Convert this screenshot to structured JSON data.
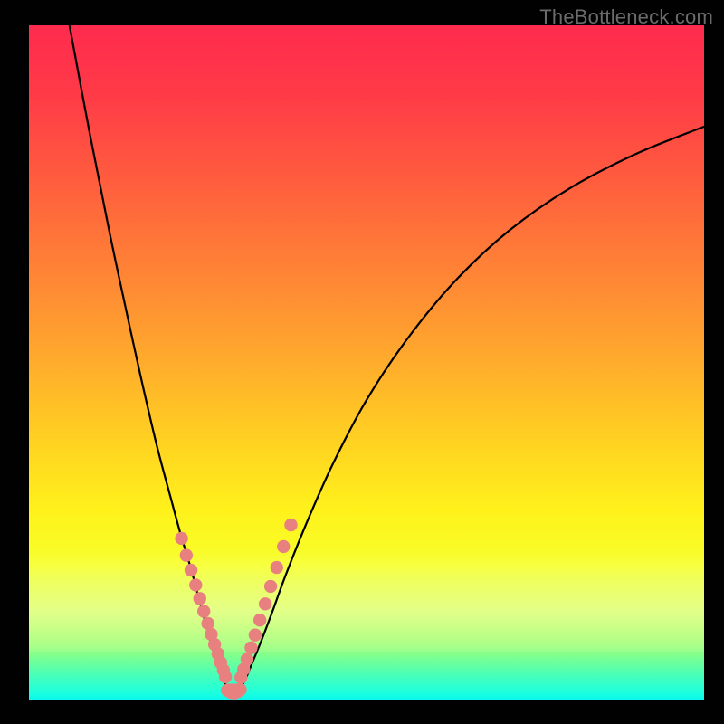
{
  "watermark": "TheBottleneck.com",
  "colors": {
    "background": "#000000",
    "gradient_top": "#ff2b4e",
    "gradient_bottom": "#07f6ed",
    "curve": "#000000",
    "marker": "#e98080"
  },
  "chart_data": {
    "type": "line",
    "title": "",
    "xlabel": "",
    "ylabel": "",
    "xlim": [
      0,
      100
    ],
    "ylim": [
      0,
      100
    ],
    "grid": false,
    "legend": false,
    "description": "Two smooth black curves on a vertical rainbow gradient. Both curves descend from the top, meet near the bottom forming a V, then the right curve rises again. Salmon-colored dot markers cluster along both arms of the V near its minimum, with a row of markers across the trough.",
    "series": [
      {
        "name": "left_curve",
        "x": [
          6,
          9,
          12,
          15,
          17,
          19,
          21,
          22.5,
          24,
          25.2,
          26.2,
          27,
          27.8,
          28.4,
          29,
          29.4
        ],
        "y": [
          100,
          84,
          69,
          55,
          46,
          37.5,
          30,
          24.5,
          19.5,
          15,
          11.3,
          8.3,
          5.8,
          4,
          2.6,
          1.7
        ]
      },
      {
        "name": "right_curve",
        "x": [
          31.2,
          32,
          33,
          34.4,
          36,
          38,
          41,
          45,
          50,
          56,
          63,
          71,
          80,
          90,
          100
        ],
        "y": [
          1.7,
          3,
          5.4,
          8.8,
          13,
          18.5,
          26,
          35,
          44.5,
          53.5,
          62,
          69.5,
          75.8,
          81,
          85
        ]
      },
      {
        "name": "trough",
        "x": [
          29.4,
          29.8,
          30.2,
          30.6,
          31.0,
          31.2
        ],
        "y": [
          1.7,
          1.2,
          1.0,
          1.1,
          1.4,
          1.7
        ]
      }
    ],
    "markers": {
      "left_arm": [
        {
          "x": 22.6,
          "y": 24.0
        },
        {
          "x": 23.3,
          "y": 21.5
        },
        {
          "x": 24.0,
          "y": 19.3
        },
        {
          "x": 24.7,
          "y": 17.1
        },
        {
          "x": 25.3,
          "y": 15.1
        },
        {
          "x": 25.9,
          "y": 13.2
        },
        {
          "x": 26.5,
          "y": 11.4
        },
        {
          "x": 27.0,
          "y": 9.8
        },
        {
          "x": 27.5,
          "y": 8.3
        },
        {
          "x": 28.0,
          "y": 6.9
        },
        {
          "x": 28.4,
          "y": 5.6
        },
        {
          "x": 28.8,
          "y": 4.5
        },
        {
          "x": 29.1,
          "y": 3.5
        }
      ],
      "right_arm": [
        {
          "x": 31.4,
          "y": 3.4
        },
        {
          "x": 31.8,
          "y": 4.6
        },
        {
          "x": 32.3,
          "y": 6.1
        },
        {
          "x": 32.9,
          "y": 7.8
        },
        {
          "x": 33.5,
          "y": 9.7
        },
        {
          "x": 34.2,
          "y": 11.9
        },
        {
          "x": 35.0,
          "y": 14.3
        },
        {
          "x": 35.8,
          "y": 16.9
        },
        {
          "x": 36.7,
          "y": 19.7
        },
        {
          "x": 37.7,
          "y": 22.8
        },
        {
          "x": 38.8,
          "y": 26.0
        }
      ],
      "trough_row": [
        {
          "x": 29.4,
          "y": 1.5
        },
        {
          "x": 29.9,
          "y": 1.2
        },
        {
          "x": 30.4,
          "y": 1.1
        },
        {
          "x": 30.9,
          "y": 1.3
        },
        {
          "x": 31.3,
          "y": 1.6
        }
      ]
    }
  }
}
